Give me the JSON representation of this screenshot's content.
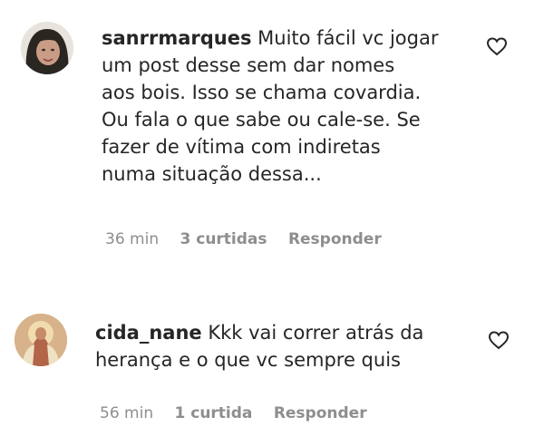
{
  "comments": [
    {
      "username": "sanrrmarques",
      "text_lines": [
        "Muito fácil vc jogar",
        "um post desse sem dar nomes",
        "aos bois. Isso se chama covardia.",
        "Ou fala o que sabe ou cale-se. Se",
        "fazer de vítima com indiretas",
        "numa situação dessa..."
      ],
      "time": "36 min",
      "likes": "3 curtidas",
      "reply": "Responder",
      "avatar_icon": "profile-photo-woman-dark-hair"
    },
    {
      "username": "cida_nane",
      "text_lines": [
        "Kkk vai correr atrás da",
        "herança e o que vc sempre quis"
      ],
      "time": "56 min",
      "likes": "1 curtida",
      "reply": "Responder",
      "avatar_icon": "profile-photo-religious-image"
    }
  ],
  "icons": {
    "like": "heart-outline-icon"
  }
}
